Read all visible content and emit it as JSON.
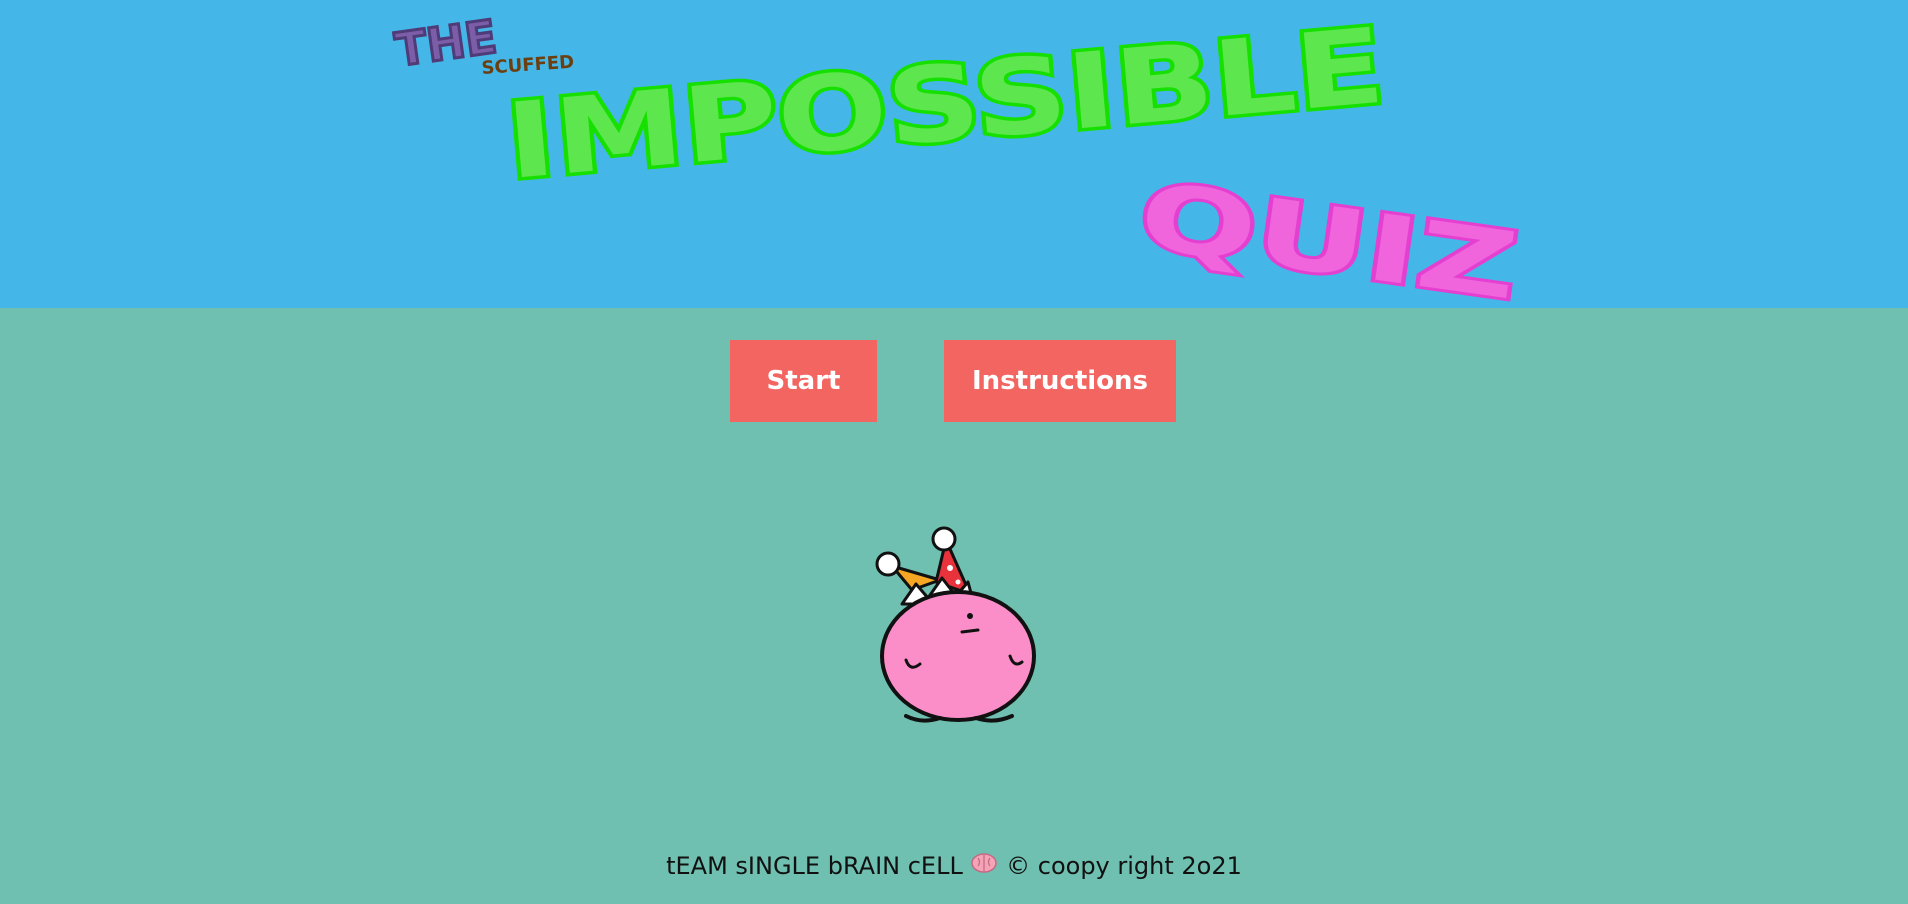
{
  "colors": {
    "header_bg": "#45b6e8",
    "main_bg": "#6fc0b1",
    "button_bg": "#f26561",
    "button_text": "#ffffff",
    "title_the": "#7b5ea7",
    "title_scuffed": "#6b3f10",
    "title_impossible": "#2ee81c",
    "title_quiz": "#ec4ed9"
  },
  "logo": {
    "the": "THE",
    "scuffed": "SCUFFED",
    "impossible": "IMPOSSIBLE",
    "quiz": "QUIZ"
  },
  "buttons": {
    "start": "Start",
    "instructions": "Instructions"
  },
  "mascot": {
    "icon": "pink-blob-jester-icon"
  },
  "footer": {
    "text_before": "tEAM sINGLE bRAIN cELL",
    "brain_icon": "brain-icon",
    "text_after": "© coopy right 2o21"
  }
}
